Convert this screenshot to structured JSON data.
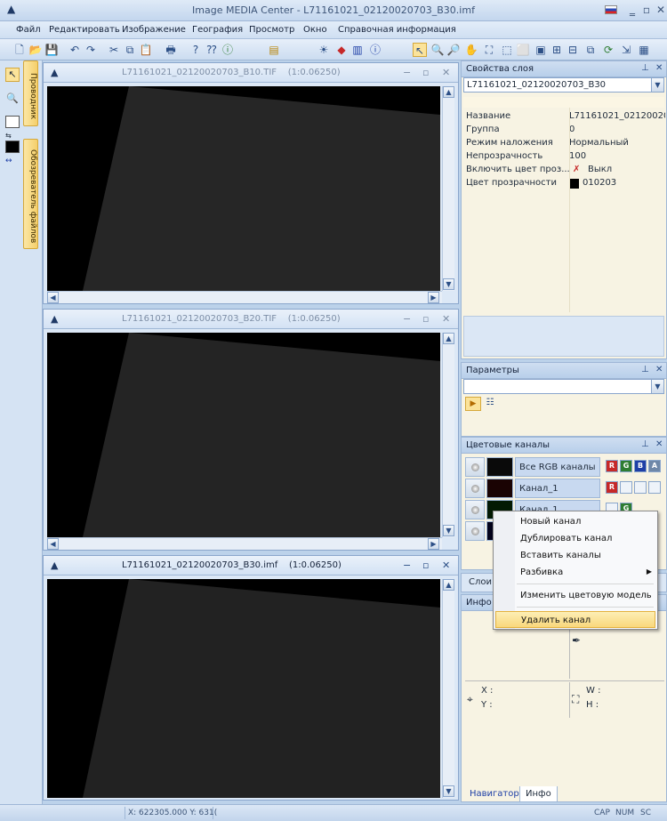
{
  "app": {
    "title": "Image MEDIA Center - L71161021_02120020703_B30.imf"
  },
  "menu": [
    "Файл",
    "Редактировать",
    "Изображение",
    "География",
    "Просмотр",
    "Окно",
    "Справочная информация"
  ],
  "left_tabs": {
    "explorer": "Проводник",
    "file_browser": "Обозреватель файлов"
  },
  "windows": [
    {
      "title": "L71161021_02120020703_B10.TIF",
      "zoom": "(1:0.06250)"
    },
    {
      "title": "L71161021_02120020703_B20.TIF",
      "zoom": "(1:0.06250)"
    },
    {
      "title": "L71161021_02120020703_B30.imf",
      "zoom": "(1:0.06250)"
    }
  ],
  "layer_props": {
    "title": "Свойства слоя",
    "selected_layer": "L71161021_02120020703_B30",
    "rows": [
      {
        "name": "Название",
        "value": "L71161021_021200207..."
      },
      {
        "name": "Группа",
        "value": "0"
      },
      {
        "name": "Режим наложения",
        "value": "Нормальный"
      },
      {
        "name": "Непрозрачность",
        "value": "100"
      },
      {
        "name": "Включить цвет проз...",
        "value": "Выкл"
      },
      {
        "name": "Цвет прозрачности",
        "value": "010203"
      }
    ]
  },
  "params": {
    "title": "Параметры"
  },
  "channels": {
    "title": "Цветовые каналы",
    "items": [
      {
        "name": "Все RGB каналы"
      },
      {
        "name": "Канал_1"
      },
      {
        "name": "Канал_1"
      }
    ]
  },
  "context_menu": [
    "Новый канал",
    "Дублировать канал",
    "Вставить каналы",
    "Разбивка",
    "Изменить цветовую модель",
    "Удалить канал"
  ],
  "layers_tab": "Слои",
  "info": {
    "title": "Инфо",
    "x_label": "X :",
    "y_label": "Y :",
    "w_label": "W :",
    "h_label": "H :"
  },
  "bottom_tabs": [
    "Навигатор",
    "Инфо"
  ],
  "status": {
    "coords": "X: 622305.000  Y: 631(",
    "cap": "CAP",
    "num": "NUM",
    "scrl": "SC"
  }
}
